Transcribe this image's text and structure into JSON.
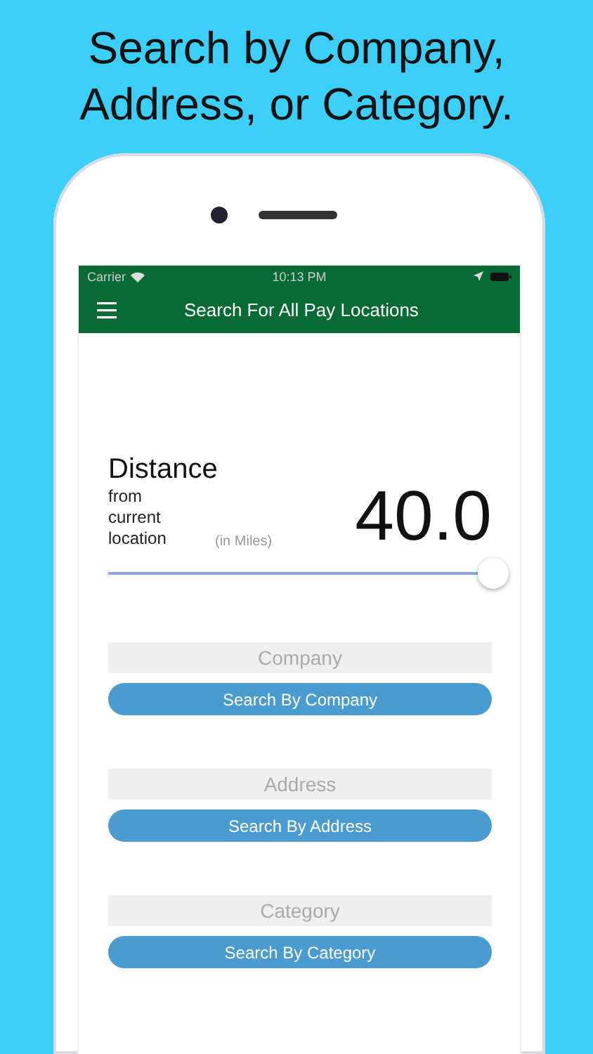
{
  "headline": "Search by Company, Address, or Category.",
  "status_bar": {
    "carrier": "Carrier",
    "time": "10:13 PM"
  },
  "nav_bar": {
    "title": "Search For All Pay Locations"
  },
  "distance": {
    "title": "Distance",
    "subtitle": "from current location",
    "unit": "(in Miles)",
    "value": "40.0",
    "slider": {
      "level": 1
    }
  },
  "searches": [
    {
      "placeholder": "Company",
      "button": "Search By Company"
    },
    {
      "placeholder": "Address",
      "button": "Search By Address"
    },
    {
      "placeholder": "Category",
      "button": "Search By Category"
    }
  ]
}
